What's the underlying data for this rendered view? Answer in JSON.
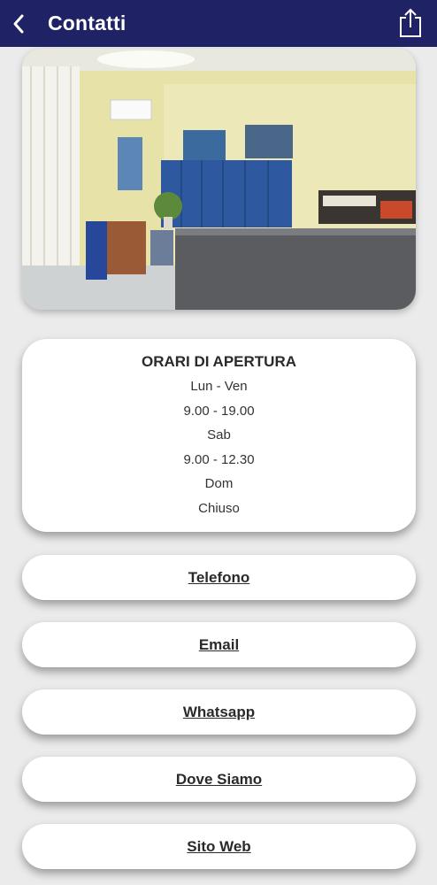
{
  "header": {
    "title": "Contatti",
    "back_icon": "chevron-left-icon",
    "share_icon": "share-icon",
    "bg_color": "#1f2366"
  },
  "photo": {
    "subject": "office-interior"
  },
  "hours": {
    "title": "ORARI DI APERTURA",
    "lines": [
      "Lun - Ven",
      "9.00 - 19.00",
      "Sab",
      "9.00 - 12.30",
      "Dom",
      "Chiuso"
    ]
  },
  "buttons": [
    {
      "label": "Telefono"
    },
    {
      "label": "Email"
    },
    {
      "label": "Whatsapp"
    },
    {
      "label": "Dove Siamo"
    },
    {
      "label": "Sito Web"
    }
  ]
}
